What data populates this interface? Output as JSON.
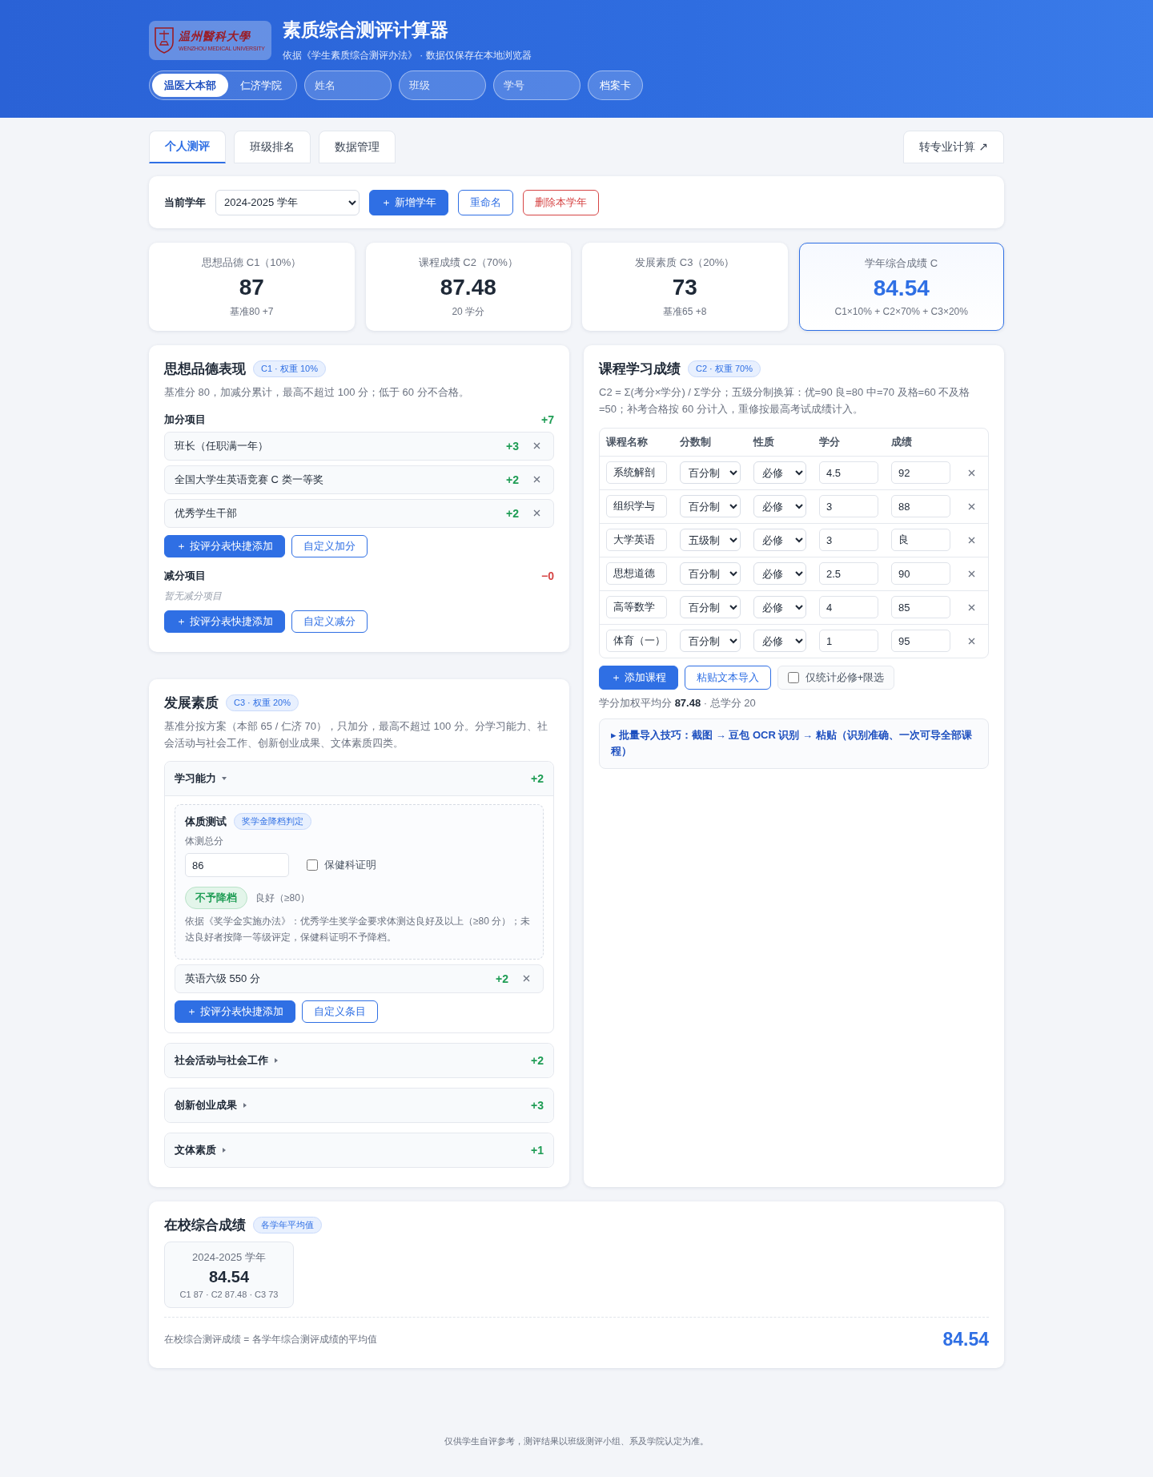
{
  "header": {
    "logo": {
      "name": "温州醫科大學",
      "subtitle": "WENZHOU MEDICAL UNIVERSITY"
    },
    "title": "素质综合测评计算器",
    "subtitle": "依据《学生素质综合测评办法》 · 数据仅保存在本地浏览器",
    "campuses": [
      {
        "label": "温医大本部",
        "selected": true
      },
      {
        "label": "仁济学院",
        "selected": false
      }
    ],
    "fields": [
      {
        "placeholder": "姓名"
      },
      {
        "placeholder": "班级"
      },
      {
        "placeholder": "学号"
      }
    ],
    "archive_button": "档案卡"
  },
  "tabs": [
    {
      "label": "个人测评",
      "selected": true
    },
    {
      "label": "班级排名",
      "selected": false
    },
    {
      "label": "数据管理",
      "selected": false
    }
  ],
  "transfer_button": "转专业计算 ↗",
  "year_bar": {
    "label": "当前学年",
    "year": "2024-2025 学年",
    "buttons": [
      {
        "kind": "primary",
        "label": "＋ 新增学年"
      },
      {
        "kind": "outline",
        "label": "重命名"
      },
      {
        "kind": "danger",
        "label": "删除本学年"
      }
    ]
  },
  "stats": [
    {
      "label": "思想品德 C1（10%）",
      "value": "87",
      "note": "基准80 +7",
      "highlight": false
    },
    {
      "label": "课程成绩 C2（70%）",
      "value": "87.48",
      "note": "20 学分",
      "highlight": false
    },
    {
      "label": "发展素质 C3（20%）",
      "value": "73",
      "note": "基准65 +8",
      "highlight": false
    },
    {
      "label": "学年综合成绩 C",
      "value": "84.54",
      "note": "C1×10% + C2×70% + C3×20%",
      "highlight": true
    }
  ],
  "morality": {
    "title": "思想品德表现",
    "badge": "C1 · 权重 10%",
    "description": "基准分 80，加减分累计，最高不超过 100 分；低于 60 分不合格。",
    "groups": [
      {
        "kind": "bonus",
        "label": "加分项目",
        "total": "+7",
        "items": [
          {
            "name": "班长（任职满一年）",
            "points": "+3"
          },
          {
            "name": "全国大学生英语竞赛 C 类一等奖",
            "points": "+2"
          },
          {
            "name": "优秀学生干部",
            "points": "+2"
          }
        ],
        "buttons": [
          "＋ 按评分表快捷添加",
          "自定义加分"
        ]
      },
      {
        "kind": "penalty",
        "label": "减分项目",
        "total": "−0",
        "empty": "暂无减分项目",
        "buttons": [
          "＋ 按评分表快捷添加",
          "自定义减分"
        ]
      }
    ]
  },
  "courses": {
    "title": "课程学习成绩",
    "badge": "C2 · 权重 70%",
    "description": "C2 = Σ(考分×学分) / Σ学分；五级分制换算：优=90 良=80 中=70 及格=60 不及格=50；补考合格按 60 分计入，重修按最高考试成绩计入。",
    "columns": [
      "课程名称",
      "分数制",
      "性质",
      "学分",
      "成绩"
    ],
    "rows": [
      {
        "name": "系统解剖",
        "scale": "百分制",
        "type": "必修",
        "credit": "4.5",
        "score": "92"
      },
      {
        "name": "组织学与",
        "scale": "百分制",
        "type": "必修",
        "credit": "3",
        "score": "88"
      },
      {
        "name": "大学英语",
        "scale": "五级制",
        "type": "必修",
        "credit": "3",
        "score": "良"
      },
      {
        "name": "思想道德",
        "scale": "百分制",
        "type": "必修",
        "credit": "2.5",
        "score": "90"
      },
      {
        "name": "高等数学",
        "scale": "百分制",
        "type": "必修",
        "credit": "4",
        "score": "85"
      },
      {
        "name": "体育（一）",
        "scale": "百分制",
        "type": "必修",
        "credit": "1",
        "score": "95"
      }
    ],
    "add_button": "＋ 添加课程",
    "paste_button": "粘贴文本导入",
    "filter": {
      "label": "仅统计必修+限选",
      "checked": false
    },
    "summary": "学分加权平均分 **87.48** · 总学分 20",
    "tip": "▸ 批量导入技巧：截图 → 豆包 OCR 识别 → 粘贴（识别准确、一次可导全部课程）"
  },
  "development": {
    "title": "发展素质",
    "badge": "C3 · 权重 20%",
    "description": "基准分按方案（本部 65 / 仁济 70），只加分，最高不超过 100 分。分学习能力、社会活动与社会工作、创新创业成果、文体素质四类。",
    "categories": [
      {
        "name": "学习能力",
        "points": "+2",
        "expanded": true,
        "fitness": {
          "title": "体质测试",
          "badge": "奖学金降档判定",
          "score_label": "体测总分",
          "score": "86",
          "certificate": {
            "label": "保健科证明",
            "checked": false
          },
          "verdict": "不予降档",
          "grade": "良好（≥80）",
          "note": "依据《奖学金实施办法》：优秀学生奖学金要求体测达良好及以上（≥80 分）；未达良好者按降一等级评定，保健科证明不予降档。"
        },
        "items": [
          {
            "name": "英语六级 550 分",
            "points": "+2"
          }
        ],
        "buttons": [
          "＋ 按评分表快捷添加",
          "自定义条目"
        ]
      },
      {
        "name": "社会活动与社会工作",
        "points": "+2",
        "expanded": false
      },
      {
        "name": "创新创业成果",
        "points": "+3",
        "expanded": false
      },
      {
        "name": "文体素质",
        "points": "+1",
        "expanded": false
      }
    ]
  },
  "overall": {
    "title": "在校综合成绩",
    "badge": "各学年平均值",
    "years": [
      {
        "year": "2024-2025 学年",
        "score": "84.54",
        "detail": "C1 87 · C2 87.48 · C3 73"
      }
    ],
    "formula": "在校综合测评成绩 = 各学年综合测评成绩的平均值",
    "score": "84.54"
  },
  "footer": "仅供学生自评参考，测评结果以班级测评小组、系及学院认定为准。"
}
